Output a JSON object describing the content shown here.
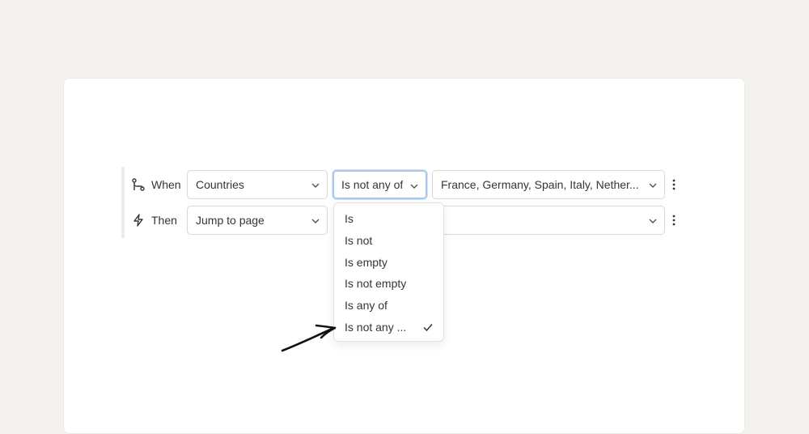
{
  "logic": {
    "when": {
      "label": "When",
      "icon": "branch-icon",
      "field_value": "Countries",
      "operator_value": "Is not any of",
      "values_value": "France, Germany, Spain, Italy, Nether..."
    },
    "then": {
      "label": "Then",
      "icon": "lightning-icon",
      "action_value": "Jump to page",
      "target_value": ""
    }
  },
  "operator_menu": {
    "options": [
      "Is",
      "Is not",
      "Is empty",
      "Is not empty",
      "Is any of",
      "Is not any ..."
    ],
    "selected_index": 5
  },
  "colors": {
    "background": "#f3f2ee",
    "card": "#ffffff",
    "focus_ring": "#aac6ea",
    "text": "#37352f"
  }
}
